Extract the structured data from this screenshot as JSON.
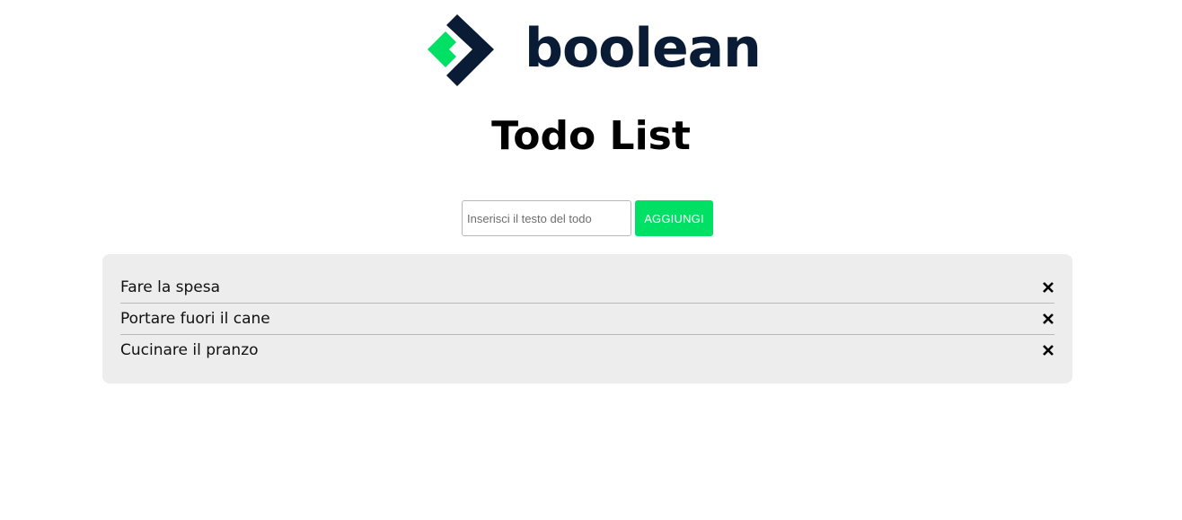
{
  "header": {
    "logo_text": "boolean",
    "logo_icon": "boolean-logo-icon",
    "title": "Todo List"
  },
  "form": {
    "input_value": "",
    "input_placeholder": "Inserisci il testo del todo",
    "add_label": "AGGIUNGI"
  },
  "todos": [
    {
      "text": "Fare la spesa",
      "delete_icon": "close-icon"
    },
    {
      "text": "Portare fuori il cane",
      "delete_icon": "close-icon"
    },
    {
      "text": "Cucinare il pranzo",
      "delete_icon": "close-icon"
    }
  ],
  "colors": {
    "brand_green": "#00e064",
    "brand_navy": "#0a1b35",
    "panel_background": "#ededed"
  }
}
